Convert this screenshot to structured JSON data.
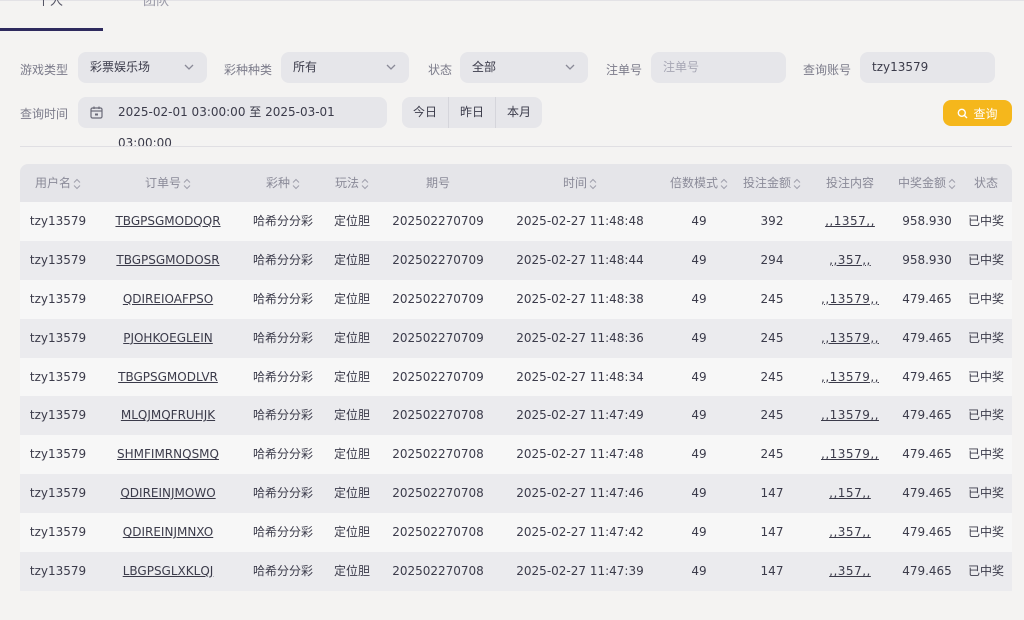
{
  "tabs": [
    {
      "label": "个人",
      "active": true
    },
    {
      "label": "团队",
      "active": false
    }
  ],
  "filters": {
    "game_type": {
      "label": "游戏类型",
      "value": "彩票娱乐场"
    },
    "lottery_type": {
      "label": "彩种种类",
      "value": "所有"
    },
    "status": {
      "label": "状态",
      "value": "全部"
    },
    "order_no": {
      "label": "注单号",
      "placeholder": "注单号"
    },
    "account": {
      "label": "查询账号",
      "value": "tzy13579"
    },
    "time": {
      "label": "查询时间",
      "value": "2025-02-01 03:00:00 至 2025-03-01 03:00:00"
    },
    "quick": [
      "今日",
      "昨日",
      "本月"
    ],
    "query_button": "查询"
  },
  "colors": {
    "accent": "#f5b71c",
    "tab_underline": "#2e2a5e"
  },
  "table": {
    "headers": [
      "用户名",
      "订单号",
      "彩种",
      "玩法",
      "期号",
      "时间",
      "倍数模式",
      "投注金额",
      "投注内容",
      "中奖金额",
      "状态"
    ],
    "rows": [
      [
        "tzy13579",
        "TBGPSGMODQQR",
        "哈希分分彩",
        "定位胆",
        "202502270709",
        "2025-02-27 11:48:48",
        "49",
        "392",
        ",,1357,,",
        "958.930",
        "已中奖"
      ],
      [
        "tzy13579",
        "TBGPSGMODOSR",
        "哈希分分彩",
        "定位胆",
        "202502270709",
        "2025-02-27 11:48:44",
        "49",
        "294",
        ",,357,,",
        "958.930",
        "已中奖"
      ],
      [
        "tzy13579",
        "QDIREIOAFPSO",
        "哈希分分彩",
        "定位胆",
        "202502270709",
        "2025-02-27 11:48:38",
        "49",
        "245",
        ",,13579,,",
        "479.465",
        "已中奖"
      ],
      [
        "tzy13579",
        "PJOHKOEGLEIN",
        "哈希分分彩",
        "定位胆",
        "202502270709",
        "2025-02-27 11:48:36",
        "49",
        "245",
        ",,13579,,",
        "479.465",
        "已中奖"
      ],
      [
        "tzy13579",
        "TBGPSGMODLVR",
        "哈希分分彩",
        "定位胆",
        "202502270709",
        "2025-02-27 11:48:34",
        "49",
        "245",
        ",,13579,,",
        "479.465",
        "已中奖"
      ],
      [
        "tzy13579",
        "MLQJMQFRUHJK",
        "哈希分分彩",
        "定位胆",
        "202502270708",
        "2025-02-27 11:47:49",
        "49",
        "245",
        ",,13579,,",
        "479.465",
        "已中奖"
      ],
      [
        "tzy13579",
        "SHMFIMRNQSMQ",
        "哈希分分彩",
        "定位胆",
        "202502270708",
        "2025-02-27 11:47:48",
        "49",
        "245",
        ",,13579,,",
        "479.465",
        "已中奖"
      ],
      [
        "tzy13579",
        "QDIREINJMOWO",
        "哈希分分彩",
        "定位胆",
        "202502270708",
        "2025-02-27 11:47:46",
        "49",
        "147",
        ",,157,,",
        "479.465",
        "已中奖"
      ],
      [
        "tzy13579",
        "QDIREINJMNXO",
        "哈希分分彩",
        "定位胆",
        "202502270708",
        "2025-02-27 11:47:42",
        "49",
        "147",
        ",,357,,",
        "479.465",
        "已中奖"
      ],
      [
        "tzy13579",
        "LBGPSGLXKLQJ",
        "哈希分分彩",
        "定位胆",
        "202502270708",
        "2025-02-27 11:47:39",
        "49",
        "147",
        ",,357,,",
        "479.465",
        "已中奖"
      ]
    ]
  }
}
